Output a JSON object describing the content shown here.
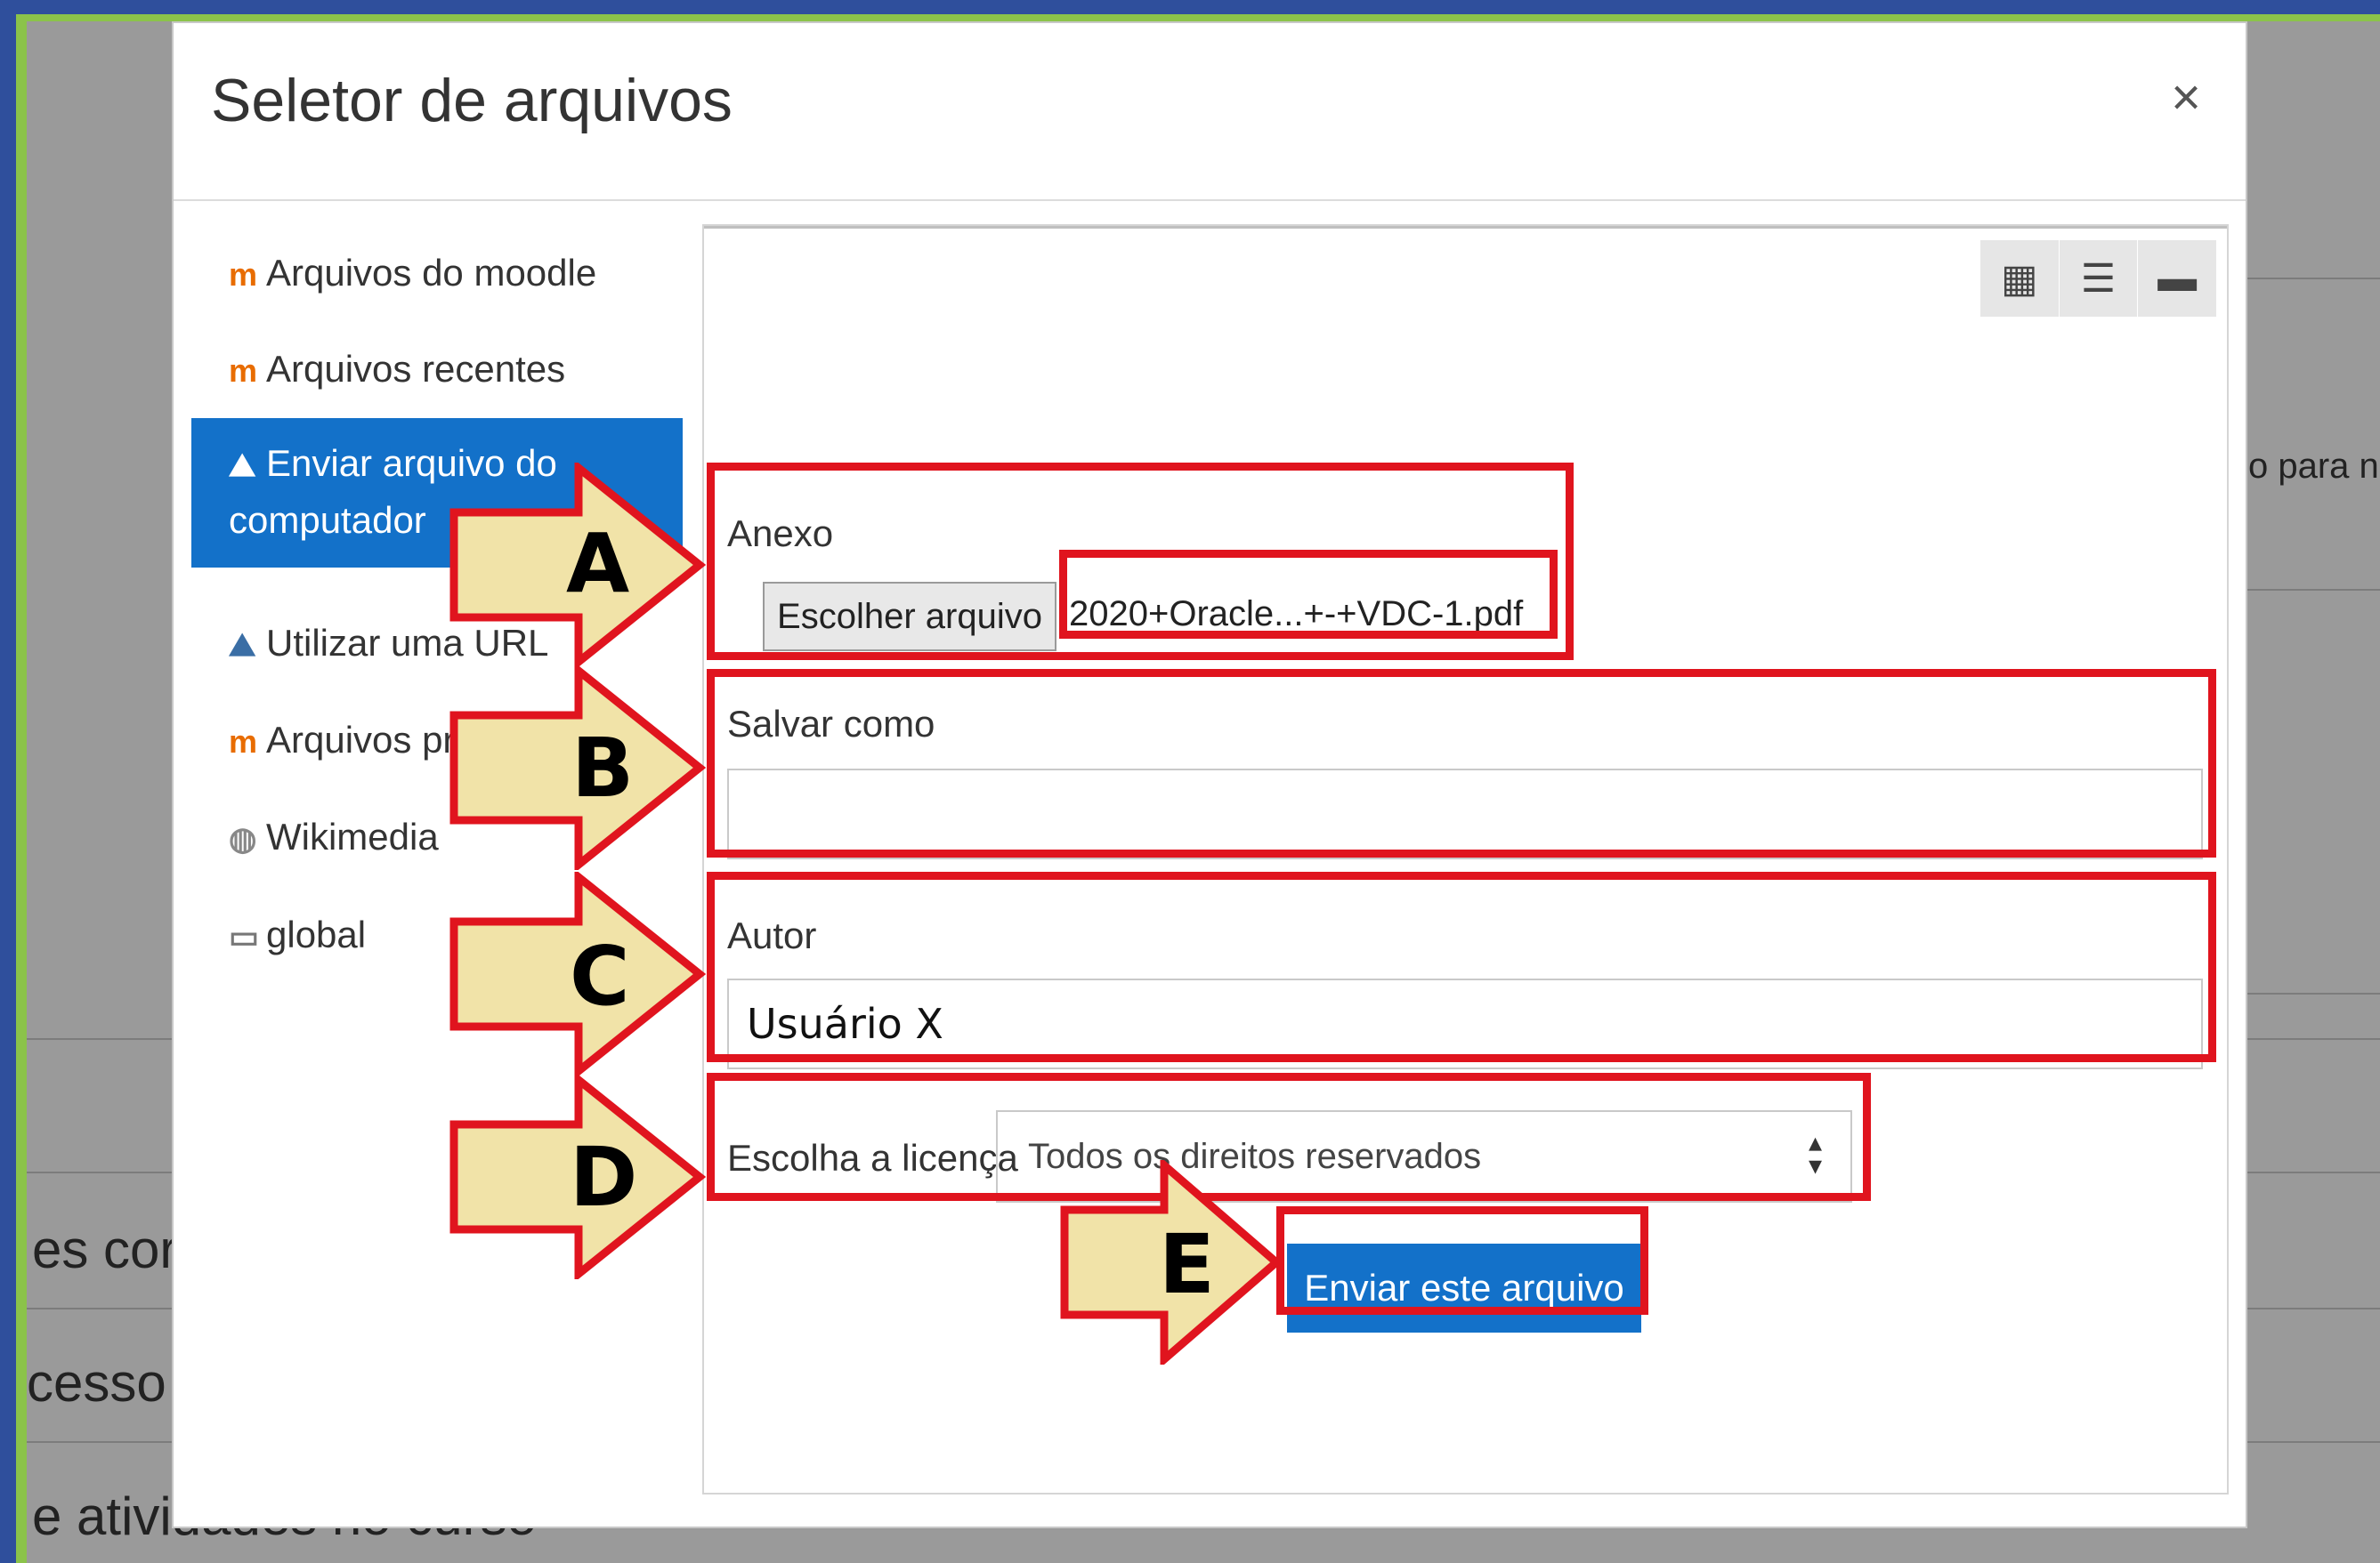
{
  "background": {
    "snippets": [
      "o para n",
      "es cor",
      "cesso",
      "e atividades no curso"
    ]
  },
  "modal": {
    "title": "Seletor de arquivos",
    "close_label": "×"
  },
  "sidebar": {
    "items": [
      {
        "label": "Arquivos do moodle",
        "icon": "moodle-icon"
      },
      {
        "label": "Arquivos recentes",
        "icon": "moodle-icon"
      },
      {
        "label_line1": "Enviar arquivo do",
        "label_line2": "computador",
        "icon": "upload-icon",
        "active": true
      },
      {
        "label": "Utilizar uma URL",
        "icon": "url-icon"
      },
      {
        "label": "Arquivos privados",
        "icon": "moodle-icon"
      },
      {
        "label": "Wikimedia",
        "icon": "wikimedia-icon"
      },
      {
        "label": "global",
        "icon": "repository-icon"
      }
    ]
  },
  "viewbar": {
    "icons": [
      "grid-view-icon",
      "list-view-icon",
      "folder-view-icon"
    ]
  },
  "form": {
    "attachment_label": "Anexo",
    "choose_file_label": "Escolher arquivo",
    "file_name": "2020+Oracle...+-+VDC-1.pdf",
    "save_as_label": "Salvar como",
    "save_as_value": "",
    "author_label": "Autor",
    "author_value": "Usuário X",
    "license_label": "Escolha a licença",
    "license_value": "Todos os direitos reservados",
    "submit_label": "Enviar este arquivo"
  },
  "annotations": {
    "letters": [
      "A",
      "B",
      "C",
      "D",
      "E"
    ],
    "highlight_color": "#e0141e",
    "arrow_fill": "#f1e3a8"
  },
  "colors": {
    "accent": "#1371c9",
    "frame_green": "#8bc34a",
    "outer_blue": "#2f4f9c"
  }
}
